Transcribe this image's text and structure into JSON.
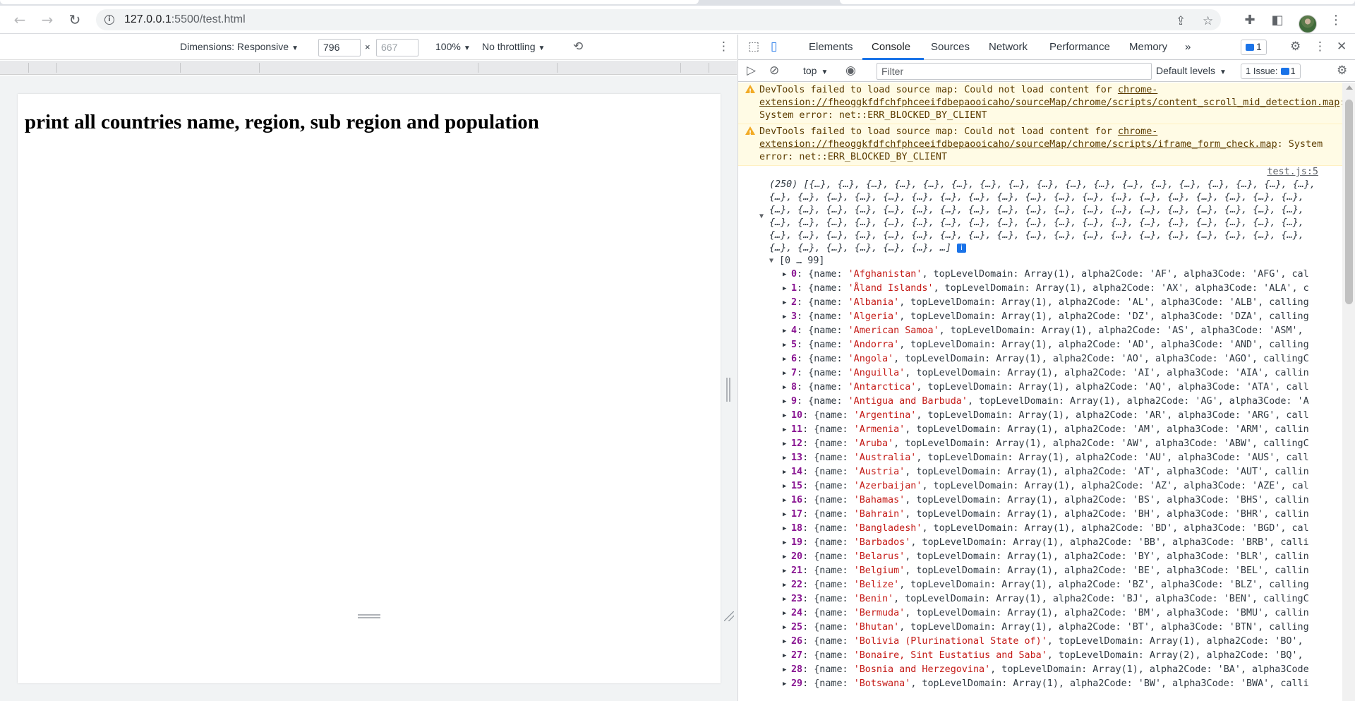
{
  "browser": {
    "url_host": "127.0.0.1",
    "url_path": ":5500/test.html",
    "icons": [
      "back-icon",
      "forward-icon",
      "reload-icon",
      "info-icon",
      "share-icon",
      "star-icon",
      "extensions-icon",
      "side-panel-icon",
      "kebab-menu-icon"
    ]
  },
  "device_toolbar": {
    "dimensions_label": "Dimensions: Responsive",
    "width": "796",
    "height": "667",
    "times": "×",
    "zoom": "100%",
    "throttling": "No throttling"
  },
  "page": {
    "heading": "print all countries name, region, sub region and population"
  },
  "devtools": {
    "tabs": [
      {
        "label": "Elements"
      },
      {
        "label": "Console"
      },
      {
        "label": "Sources"
      },
      {
        "label": "Network"
      },
      {
        "label": "Performance"
      },
      {
        "label": "Memory"
      }
    ],
    "more_tabs": "»",
    "issues_badge_count": "1",
    "context": "top",
    "filter_placeholder": "Filter",
    "levels": "Default levels",
    "issue_label": "1 Issue:",
    "issue_count": "1",
    "accent_color": "#1a73e8"
  },
  "console": {
    "warnings": [
      {
        "prefix": "DevTools failed to load source map: Could not load content for ",
        "link": "chrome-extension://fheoggkfdfchfphceeifdbepaooicaho/sourceMap/chrome/scripts/content_scroll_mid_detection.map",
        "suffix": ": System error: net::ERR_BLOCKED_BY_CLIENT"
      },
      {
        "prefix": "DevTools failed to load source map: Could not load content for ",
        "link": "chrome-extension://fheoggkfdfchfphceeifdbepaooicaho/sourceMap/chrome/scripts/iframe_form_check.map",
        "suffix": ": System error: net::ERR_BLOCKED_BY_CLIENT"
      }
    ],
    "source": "test.js:5",
    "summary": "(250) [{…}, {…}, {…}, {…}, {…}, {…}, {…}, {…}, {…}, {…}, {…}, {…}, {…}, {…}, {…}, {…}, {…}, {…}, {…}, {…}, {…}, {…}, {…}, {…}, {…}, {…}, {…}, {…}, {…}, {…}, {…}, {…}, {…}, {…}, {…}, {…}, {…}, {…}, {…}, {…}, {…}, {…}, {…}, {…}, {…}, {…}, {…}, {…}, {…}, {…}, {…}, {…}, {…}, {…}, {…}, {…}, {…}, {…}, {…}, {…}, {…}, {…}, {…}, {…}, {…}, {…}, {…}, {…}, {…}, {…}, {…}, {…}, {…}, {…}, {…}, {…}, {…}, {…}, {…}, {…}, {…}, {…}, {…}, {…}, {…}, {…}, {…}, {…}, {…}, {…}, {…}, {…}, {…}, {…}, {…}, {…}, {…}, {…}, {…}, {…}, …]",
    "group_label": "[0 … 99]",
    "rows": [
      {
        "i": "0",
        "name": "'Afghanistan'",
        "rest": ", topLevelDomain: Array(1), alpha2Code: 'AF', alpha3Code: 'AFG', cal"
      },
      {
        "i": "1",
        "name": "'Åland Islands'",
        "rest": ", topLevelDomain: Array(1), alpha2Code: 'AX', alpha3Code: 'ALA', c"
      },
      {
        "i": "2",
        "name": "'Albania'",
        "rest": ", topLevelDomain: Array(1), alpha2Code: 'AL', alpha3Code: 'ALB', calling"
      },
      {
        "i": "3",
        "name": "'Algeria'",
        "rest": ", topLevelDomain: Array(1), alpha2Code: 'DZ', alpha3Code: 'DZA', calling"
      },
      {
        "i": "4",
        "name": "'American Samoa'",
        "rest": ", topLevelDomain: Array(1), alpha2Code: 'AS', alpha3Code: 'ASM',"
      },
      {
        "i": "5",
        "name": "'Andorra'",
        "rest": ", topLevelDomain: Array(1), alpha2Code: 'AD', alpha3Code: 'AND', calling"
      },
      {
        "i": "6",
        "name": "'Angola'",
        "rest": ", topLevelDomain: Array(1), alpha2Code: 'AO', alpha3Code: 'AGO', callingC"
      },
      {
        "i": "7",
        "name": "'Anguilla'",
        "rest": ", topLevelDomain: Array(1), alpha2Code: 'AI', alpha3Code: 'AIA', callin"
      },
      {
        "i": "8",
        "name": "'Antarctica'",
        "rest": ", topLevelDomain: Array(1), alpha2Code: 'AQ', alpha3Code: 'ATA', call"
      },
      {
        "i": "9",
        "name": "'Antigua and Barbuda'",
        "rest": ", topLevelDomain: Array(1), alpha2Code: 'AG', alpha3Code: 'A"
      },
      {
        "i": "10",
        "name": "'Argentina'",
        "rest": ", topLevelDomain: Array(1), alpha2Code: 'AR', alpha3Code: 'ARG', call"
      },
      {
        "i": "11",
        "name": "'Armenia'",
        "rest": ", topLevelDomain: Array(1), alpha2Code: 'AM', alpha3Code: 'ARM', callin"
      },
      {
        "i": "12",
        "name": "'Aruba'",
        "rest": ", topLevelDomain: Array(1), alpha2Code: 'AW', alpha3Code: 'ABW', callingC"
      },
      {
        "i": "13",
        "name": "'Australia'",
        "rest": ", topLevelDomain: Array(1), alpha2Code: 'AU', alpha3Code: 'AUS', call"
      },
      {
        "i": "14",
        "name": "'Austria'",
        "rest": ", topLevelDomain: Array(1), alpha2Code: 'AT', alpha3Code: 'AUT', callin"
      },
      {
        "i": "15",
        "name": "'Azerbaijan'",
        "rest": ", topLevelDomain: Array(1), alpha2Code: 'AZ', alpha3Code: 'AZE', cal"
      },
      {
        "i": "16",
        "name": "'Bahamas'",
        "rest": ", topLevelDomain: Array(1), alpha2Code: 'BS', alpha3Code: 'BHS', callin"
      },
      {
        "i": "17",
        "name": "'Bahrain'",
        "rest": ", topLevelDomain: Array(1), alpha2Code: 'BH', alpha3Code: 'BHR', callin"
      },
      {
        "i": "18",
        "name": "'Bangladesh'",
        "rest": ", topLevelDomain: Array(1), alpha2Code: 'BD', alpha3Code: 'BGD', cal"
      },
      {
        "i": "19",
        "name": "'Barbados'",
        "rest": ", topLevelDomain: Array(1), alpha2Code: 'BB', alpha3Code: 'BRB', calli"
      },
      {
        "i": "20",
        "name": "'Belarus'",
        "rest": ", topLevelDomain: Array(1), alpha2Code: 'BY', alpha3Code: 'BLR', callin"
      },
      {
        "i": "21",
        "name": "'Belgium'",
        "rest": ", topLevelDomain: Array(1), alpha2Code: 'BE', alpha3Code: 'BEL', callin"
      },
      {
        "i": "22",
        "name": "'Belize'",
        "rest": ", topLevelDomain: Array(1), alpha2Code: 'BZ', alpha3Code: 'BLZ', calling"
      },
      {
        "i": "23",
        "name": "'Benin'",
        "rest": ", topLevelDomain: Array(1), alpha2Code: 'BJ', alpha3Code: 'BEN', callingC"
      },
      {
        "i": "24",
        "name": "'Bermuda'",
        "rest": ", topLevelDomain: Array(1), alpha2Code: 'BM', alpha3Code: 'BMU', callin"
      },
      {
        "i": "25",
        "name": "'Bhutan'",
        "rest": ", topLevelDomain: Array(1), alpha2Code: 'BT', alpha3Code: 'BTN', calling"
      },
      {
        "i": "26",
        "name": "'Bolivia (Plurinational State of)'",
        "rest": ", topLevelDomain: Array(1), alpha2Code: 'BO',"
      },
      {
        "i": "27",
        "name": "'Bonaire, Sint Eustatius and Saba'",
        "rest": ", topLevelDomain: Array(2), alpha2Code: 'BQ',"
      },
      {
        "i": "28",
        "name": "'Bosnia and Herzegovina'",
        "rest": ", topLevelDomain: Array(1), alpha2Code: 'BA', alpha3Code"
      },
      {
        "i": "29",
        "name": "'Botswana'",
        "rest": ", topLevelDomain: Array(1), alpha2Code: 'BW', alpha3Code: 'BWA', calli"
      }
    ]
  }
}
